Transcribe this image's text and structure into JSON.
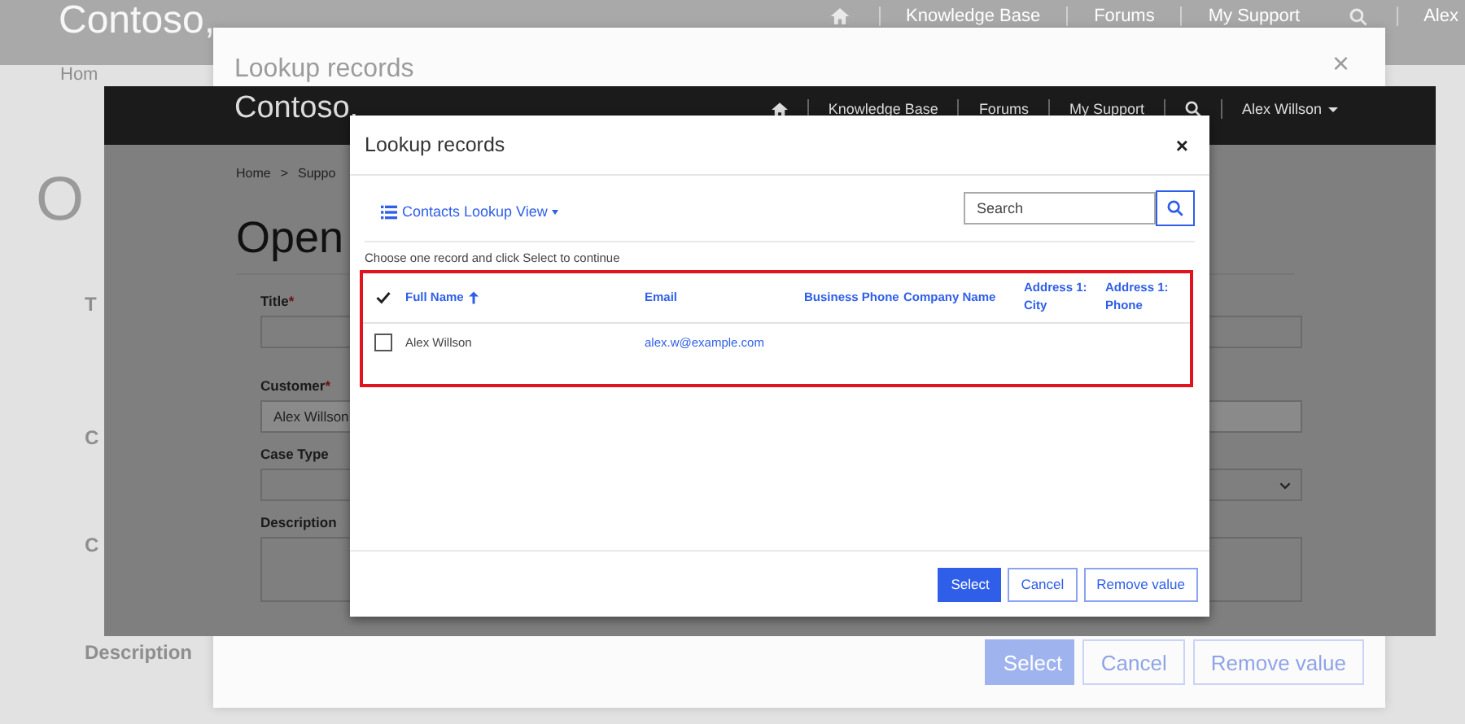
{
  "background_page": {
    "logo": "Contoso,",
    "nav": [
      "Knowledge Base",
      "Forums",
      "My Support",
      "Alex"
    ],
    "breadcrumb": "Hom",
    "heading": "O",
    "field_labels": [
      "T",
      "C",
      "C",
      "Description"
    ],
    "dialog": {
      "title": "Lookup records",
      "close": "×",
      "buttons": [
        {
          "label": "Select",
          "kind": "primary"
        },
        {
          "label": "Cancel",
          "kind": "secondary"
        },
        {
          "label": "Remove value",
          "kind": "secondary"
        }
      ]
    }
  },
  "portal_page": {
    "logo": "Contoso,",
    "nav": [
      "Knowledge Base",
      "Forums",
      "My Support"
    ],
    "user_menu": "Alex Willson",
    "breadcrumb": [
      "Home",
      ">",
      "Suppo"
    ],
    "heading": "Open",
    "fields": [
      {
        "label": "Title",
        "required_mark": "*",
        "kind": "text"
      },
      {
        "label": "Customer",
        "required_mark": "*",
        "kind": "lookup",
        "value": "Alex Willson"
      },
      {
        "label": "Case Type",
        "kind": "select"
      },
      {
        "label": "Description",
        "kind": "textarea"
      }
    ]
  },
  "lookup_dialog": {
    "title": "Lookup records",
    "close": "×",
    "view": "Contacts Lookup View",
    "search": {
      "placeholder": "Search"
    },
    "instruction": "Choose one record and click Select to continue",
    "table": {
      "columns": [
        {
          "label": "Full Name",
          "sorted": true
        },
        {
          "label": "Email",
          "sorted": false
        },
        {
          "label": "Business Phone",
          "sorted": false
        },
        {
          "label": "Company Name",
          "sorted": false
        },
        {
          "label": "Address 1: City",
          "sorted": false
        },
        {
          "label": "Address 1: Phone",
          "sorted": false
        }
      ],
      "rows": [
        {
          "selected": false,
          "full_name": "Alex Willson",
          "email": "alex.w@example.com"
        }
      ]
    },
    "buttons": [
      {
        "label": "Select",
        "kind": "primary"
      },
      {
        "label": "Cancel",
        "kind": "secondary"
      },
      {
        "label": "Remove value",
        "kind": "secondary"
      }
    ]
  }
}
